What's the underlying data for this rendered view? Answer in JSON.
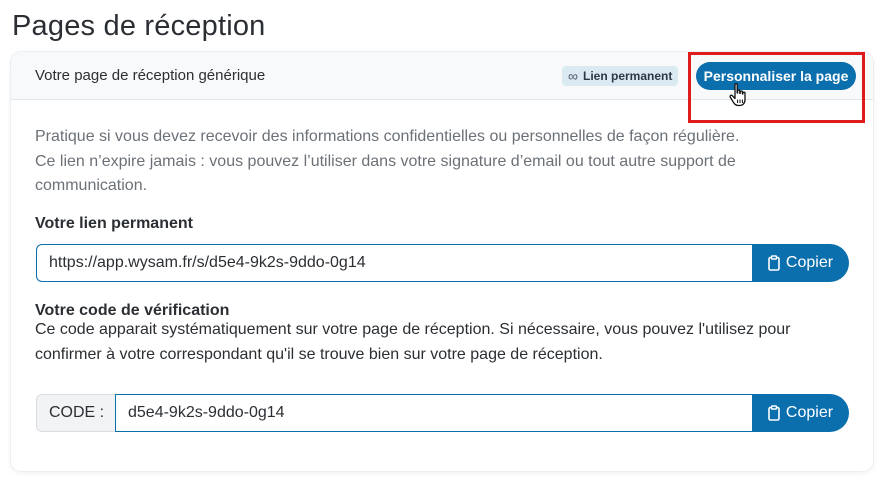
{
  "page": {
    "title": "Pages de réception"
  },
  "card": {
    "header_title": "Votre page de réception générique",
    "badge": {
      "icon": "infinity-icon",
      "label": "Lien permanent"
    },
    "customize_button": "Personnaliser la page",
    "description_line1": "Pratique si vous devez recevoir des informations confidentielles ou personnelles de façon régulière.",
    "description_line2": "Ce lien n’expire jamais : vous pouvez l’utiliser dans votre signature d’email ou tout autre support de communication.",
    "permanent_link": {
      "label": "Votre lien permanent",
      "value": "https://app.wysam.fr/s/d5e4-9k2s-9ddo-0g14",
      "copy_label": "Copier"
    },
    "verification": {
      "label": "Votre code de vérification",
      "description": "Ce code apparait systématiquement sur votre page de réception. Si nécessaire, vous pouvez l'utilisez pour confirmer à votre correspondant qu'il se trouve bien sur votre page de réception.",
      "prefix": "CODE :",
      "value": "d5e4-9k2s-9ddo-0g14",
      "copy_label": "Copier"
    }
  },
  "colors": {
    "primary": "#0b6fae",
    "highlight": "#e01b1b",
    "badge_bg": "#dbe9f3"
  }
}
